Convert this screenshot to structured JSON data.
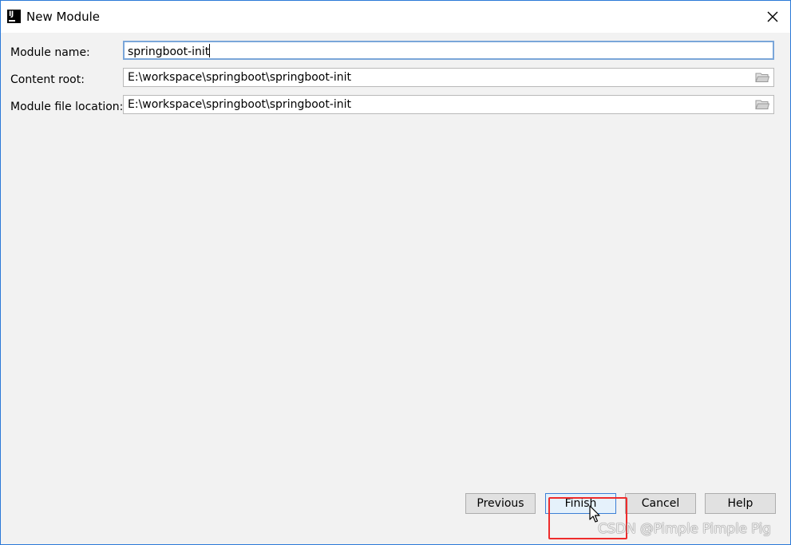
{
  "window": {
    "title": "New Module",
    "icon": "intellij-icon",
    "close_icon": "close-icon"
  },
  "form": {
    "module_name": {
      "label": "Module name:",
      "value": "springboot-init"
    },
    "content_root": {
      "label": "Content root:",
      "value": "E:\\workspace\\springboot\\springboot-init",
      "browse_icon": "folder-icon"
    },
    "module_file_location": {
      "label": "Module file location:",
      "value": "E:\\workspace\\springboot\\springboot-init",
      "browse_icon": "folder-icon"
    }
  },
  "buttons": {
    "previous": "Previous",
    "finish": "Finish",
    "cancel": "Cancel",
    "help": "Help"
  },
  "annotation": {
    "highlight_color": "#ee2c2c"
  },
  "watermark": "CSDN @Pimple Pimple Pig"
}
